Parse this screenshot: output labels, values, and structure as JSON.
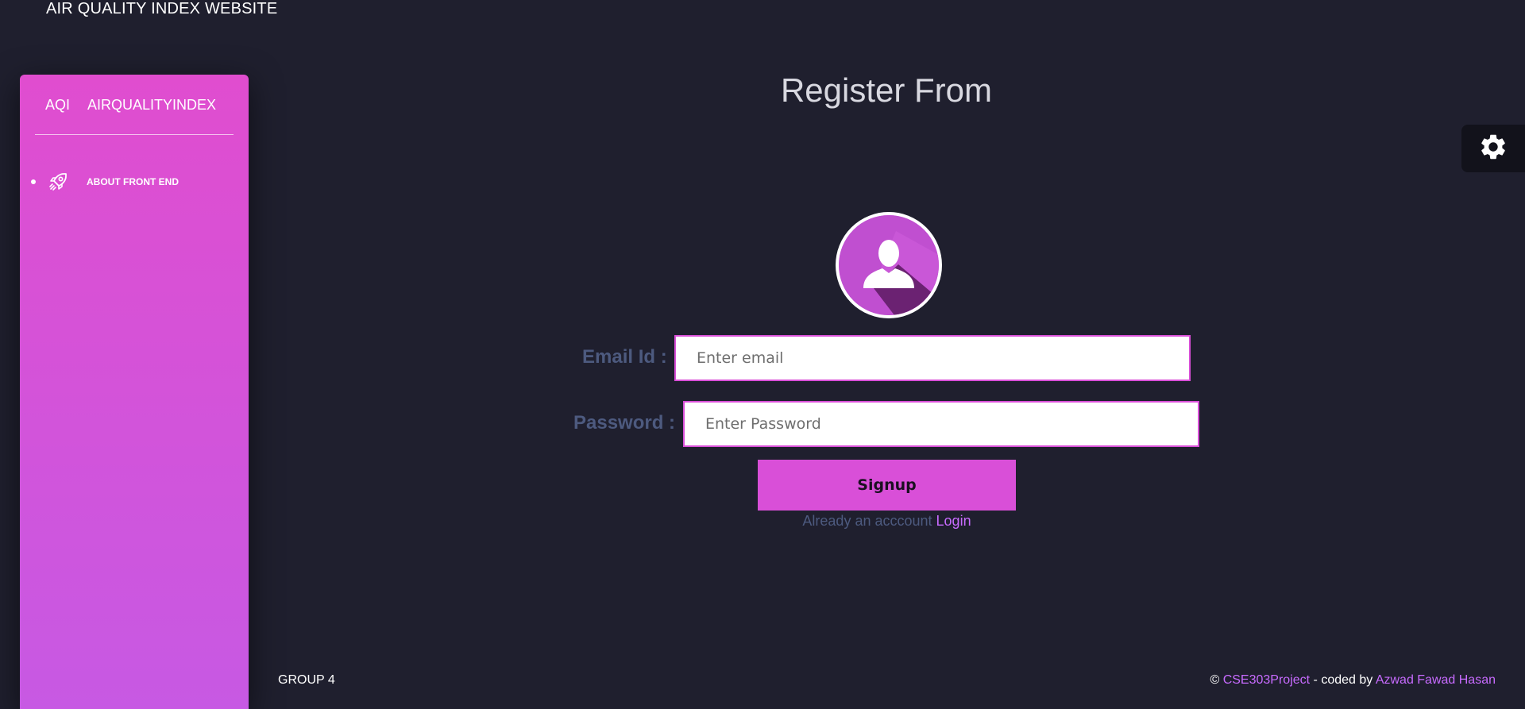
{
  "site_title": "AIR QUALITY INDEX WEBSITE",
  "sidebar": {
    "brand_short": "AQI",
    "brand_long": "AIRQUALITYINDEX",
    "items": [
      {
        "label": "ABOUT FRONT END",
        "icon": "rocket-icon"
      }
    ]
  },
  "settings": {
    "icon": "gear-icon"
  },
  "form": {
    "title": "Register From",
    "avatar_icon": "user-avatar-icon",
    "email_label": "Email Id :",
    "email_placeholder": "Enter email",
    "email_value": "",
    "password_label": "Password :",
    "password_placeholder": "Enter Password",
    "password_value": "",
    "signup_label": "Signup",
    "account_text": "Already an acccount",
    "login_label": "Login"
  },
  "footer": {
    "left": "GROUP 4",
    "copyright": "©",
    "project_link": "CSE303Project",
    "coded_by": " - coded by ",
    "author_link": "Azwad Fawad Hasan"
  },
  "colors": {
    "background": "#1f1f2e",
    "accent": "#d94fd8",
    "sidebar_top": "#e04dcf",
    "sidebar_bottom": "#c759e3",
    "label": "#4d5a7f",
    "link": "#c86bff"
  }
}
